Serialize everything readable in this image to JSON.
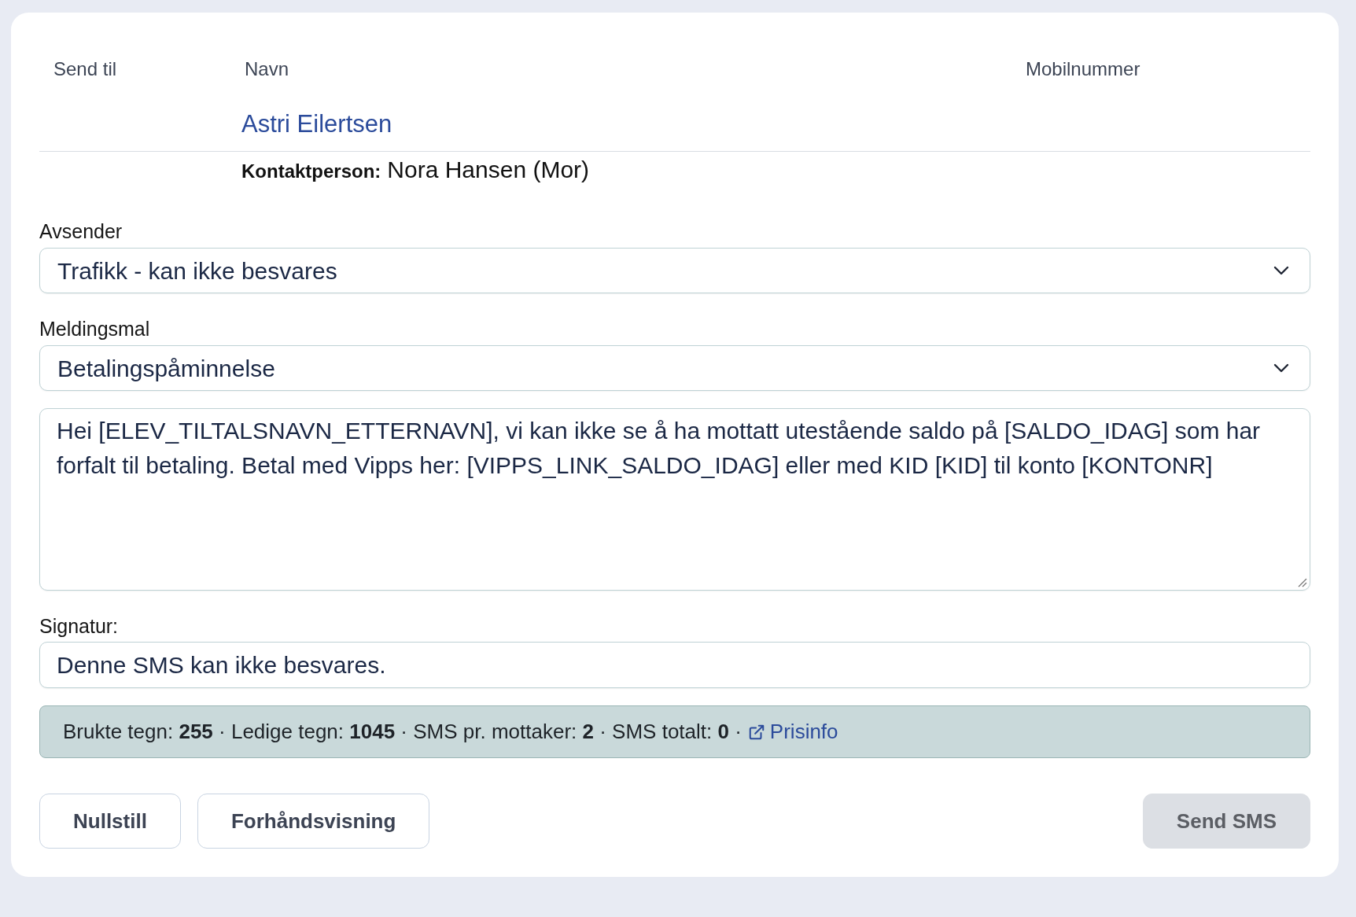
{
  "recipients_table": {
    "columns": [
      "Send til",
      "Navn",
      "Mobilnummer"
    ],
    "rows": [
      {
        "name": "Astri Eilertsen",
        "contact_label": "Kontaktperson:",
        "contact_name": "Nora Hansen (Mor)"
      }
    ]
  },
  "sender_select": {
    "label": "Avsender",
    "value": "Trafikk - kan ikke besvares"
  },
  "template_select": {
    "label": "Meldingsmal",
    "value": "Betalingspåminnelse"
  },
  "message": {
    "value": "Hei [ELEV_TILTALSNAVN_ETTERNAVN], vi kan ikke se å ha mottatt utestående saldo på [SALDO_IDAG] som har forfalt til betaling. Betal med Vipps her: [VIPPS_LINK_SALDO_IDAG] eller med KID [KID] til konto [KONTONR]"
  },
  "signature": {
    "label": "Signatur:",
    "value": "Denne SMS kan ikke besvares."
  },
  "stats_bar": {
    "summary": "Brukte tegn: **255** · Ledige tegn: **1045** · SMS pr. mottaker: **2** · SMS totalt: **0** ·",
    "link": "Prisinfo"
  },
  "buttons": [
    {
      "label": "Nullstill",
      "disabled": false
    },
    {
      "label": "Forhåndsvisning",
      "disabled": false
    },
    {
      "label": "Send SMS",
      "disabled": true
    }
  ]
}
